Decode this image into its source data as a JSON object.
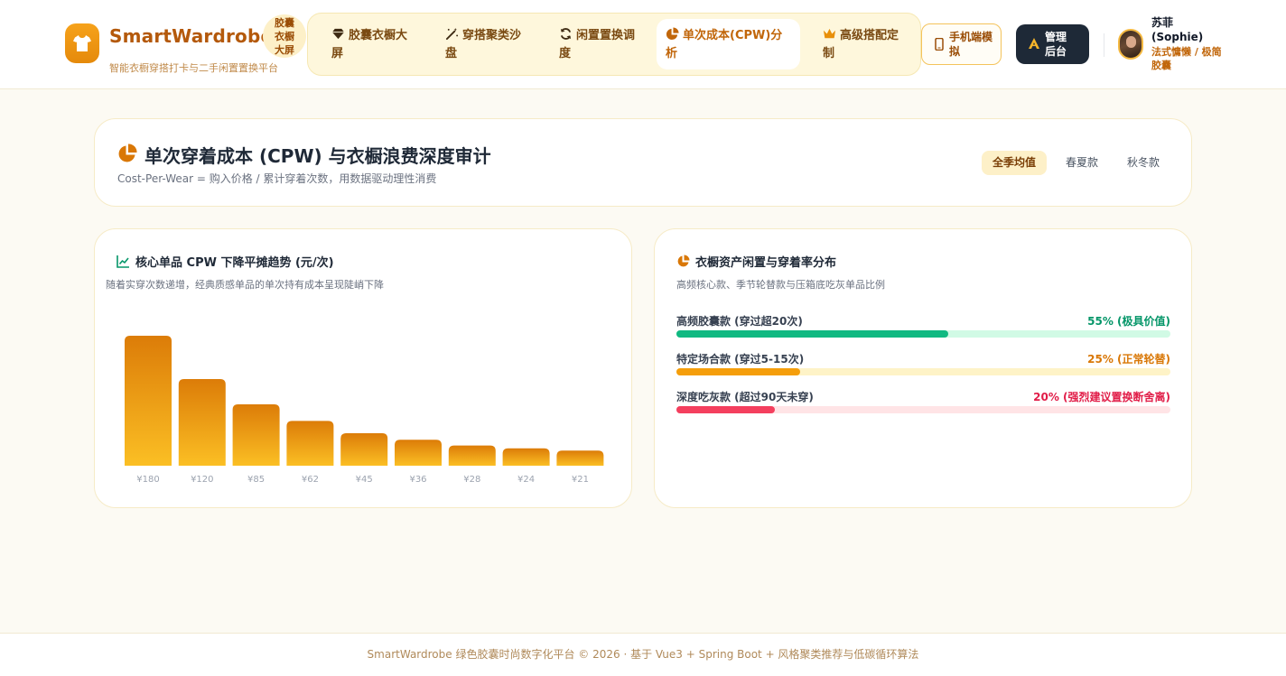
{
  "app": {
    "brand": "SmartWardrobe",
    "subtitle": "智能衣橱穿搭打卡与二手闲置置换平台",
    "badge": "胶囊衣橱大屏"
  },
  "nav": {
    "items": [
      {
        "label": "胶囊衣橱大屏",
        "icon": "gem-icon"
      },
      {
        "label": "穿搭聚类沙盘",
        "icon": "magic-wand-icon"
      },
      {
        "label": "闲置置换调度",
        "icon": "refresh-icon"
      },
      {
        "label": "单次成本(CPW)分析",
        "icon": "pie-chart-icon",
        "active": true
      },
      {
        "label": "高级搭配定制",
        "icon": "crown-icon"
      }
    ]
  },
  "header_actions": {
    "mobile_label": "手机端模拟",
    "admin_label": "管理后台"
  },
  "user": {
    "name": "苏菲 (Sophie)",
    "role": "法式慵懒 / 极简胶囊"
  },
  "page": {
    "title": "单次穿着成本 (CPW) 与衣橱浪费深度审计",
    "subtitle": "Cost-Per-Wear = 购入价格 / 累计穿着次数，用数据驱动理性消费",
    "filters": [
      {
        "label": "全季均值",
        "active": true
      },
      {
        "label": "春夏款",
        "active": false
      },
      {
        "label": "秋冬款",
        "active": false
      }
    ]
  },
  "trend_card": {
    "title": "核心单品 CPW 下降平摊趋势 (元/次)",
    "subtitle": "随着实穿次数递增，经典质感单品的单次持有成本呈现陡峭下降"
  },
  "chart_data": {
    "type": "bar",
    "categories": [
      "¥180",
      "¥120",
      "¥85",
      "¥62",
      "¥45",
      "¥36",
      "¥28",
      "¥24",
      "¥21"
    ],
    "values": [
      180,
      120,
      85,
      62,
      45,
      36,
      28,
      24,
      21
    ],
    "title": "核心单品 CPW 下降平摊趋势 (元/次)",
    "xlabel": "",
    "ylabel": "",
    "ylim": [
      0,
      180
    ],
    "grid": false,
    "colors": {
      "top": "#dc7c08",
      "bottom": "#fbbf24"
    }
  },
  "distribution_card": {
    "title": "衣橱资产闲置与穿着率分布",
    "subtitle": "高频核心款、季节轮替款与压箱底吃灰单品比例",
    "rows": [
      {
        "label": "高频胶囊款 (穿过超20次)",
        "value_text": "55% (极具价值)",
        "percent": 55,
        "color": "#10b981",
        "track": "#d1fae5",
        "text_color": "#059669"
      },
      {
        "label": "特定场合款 (穿过5-15次)",
        "value_text": "25% (正常轮替)",
        "percent": 25,
        "color": "#f59e0b",
        "track": "#fef3c7",
        "text_color": "#d97706"
      },
      {
        "label": "深度吃灰款 (超过90天未穿)",
        "value_text": "20% (强烈建议置换断舍离)",
        "percent": 20,
        "color": "#f43f5e",
        "track": "#ffe4e6",
        "text_color": "#e11d48"
      }
    ]
  },
  "footer": {
    "text": "SmartWardrobe 绿色胶囊时尚数字化平台 © 2026 · 基于 Vue3 + Spring Boot + 风格聚类推荐与低碳循环算法"
  }
}
